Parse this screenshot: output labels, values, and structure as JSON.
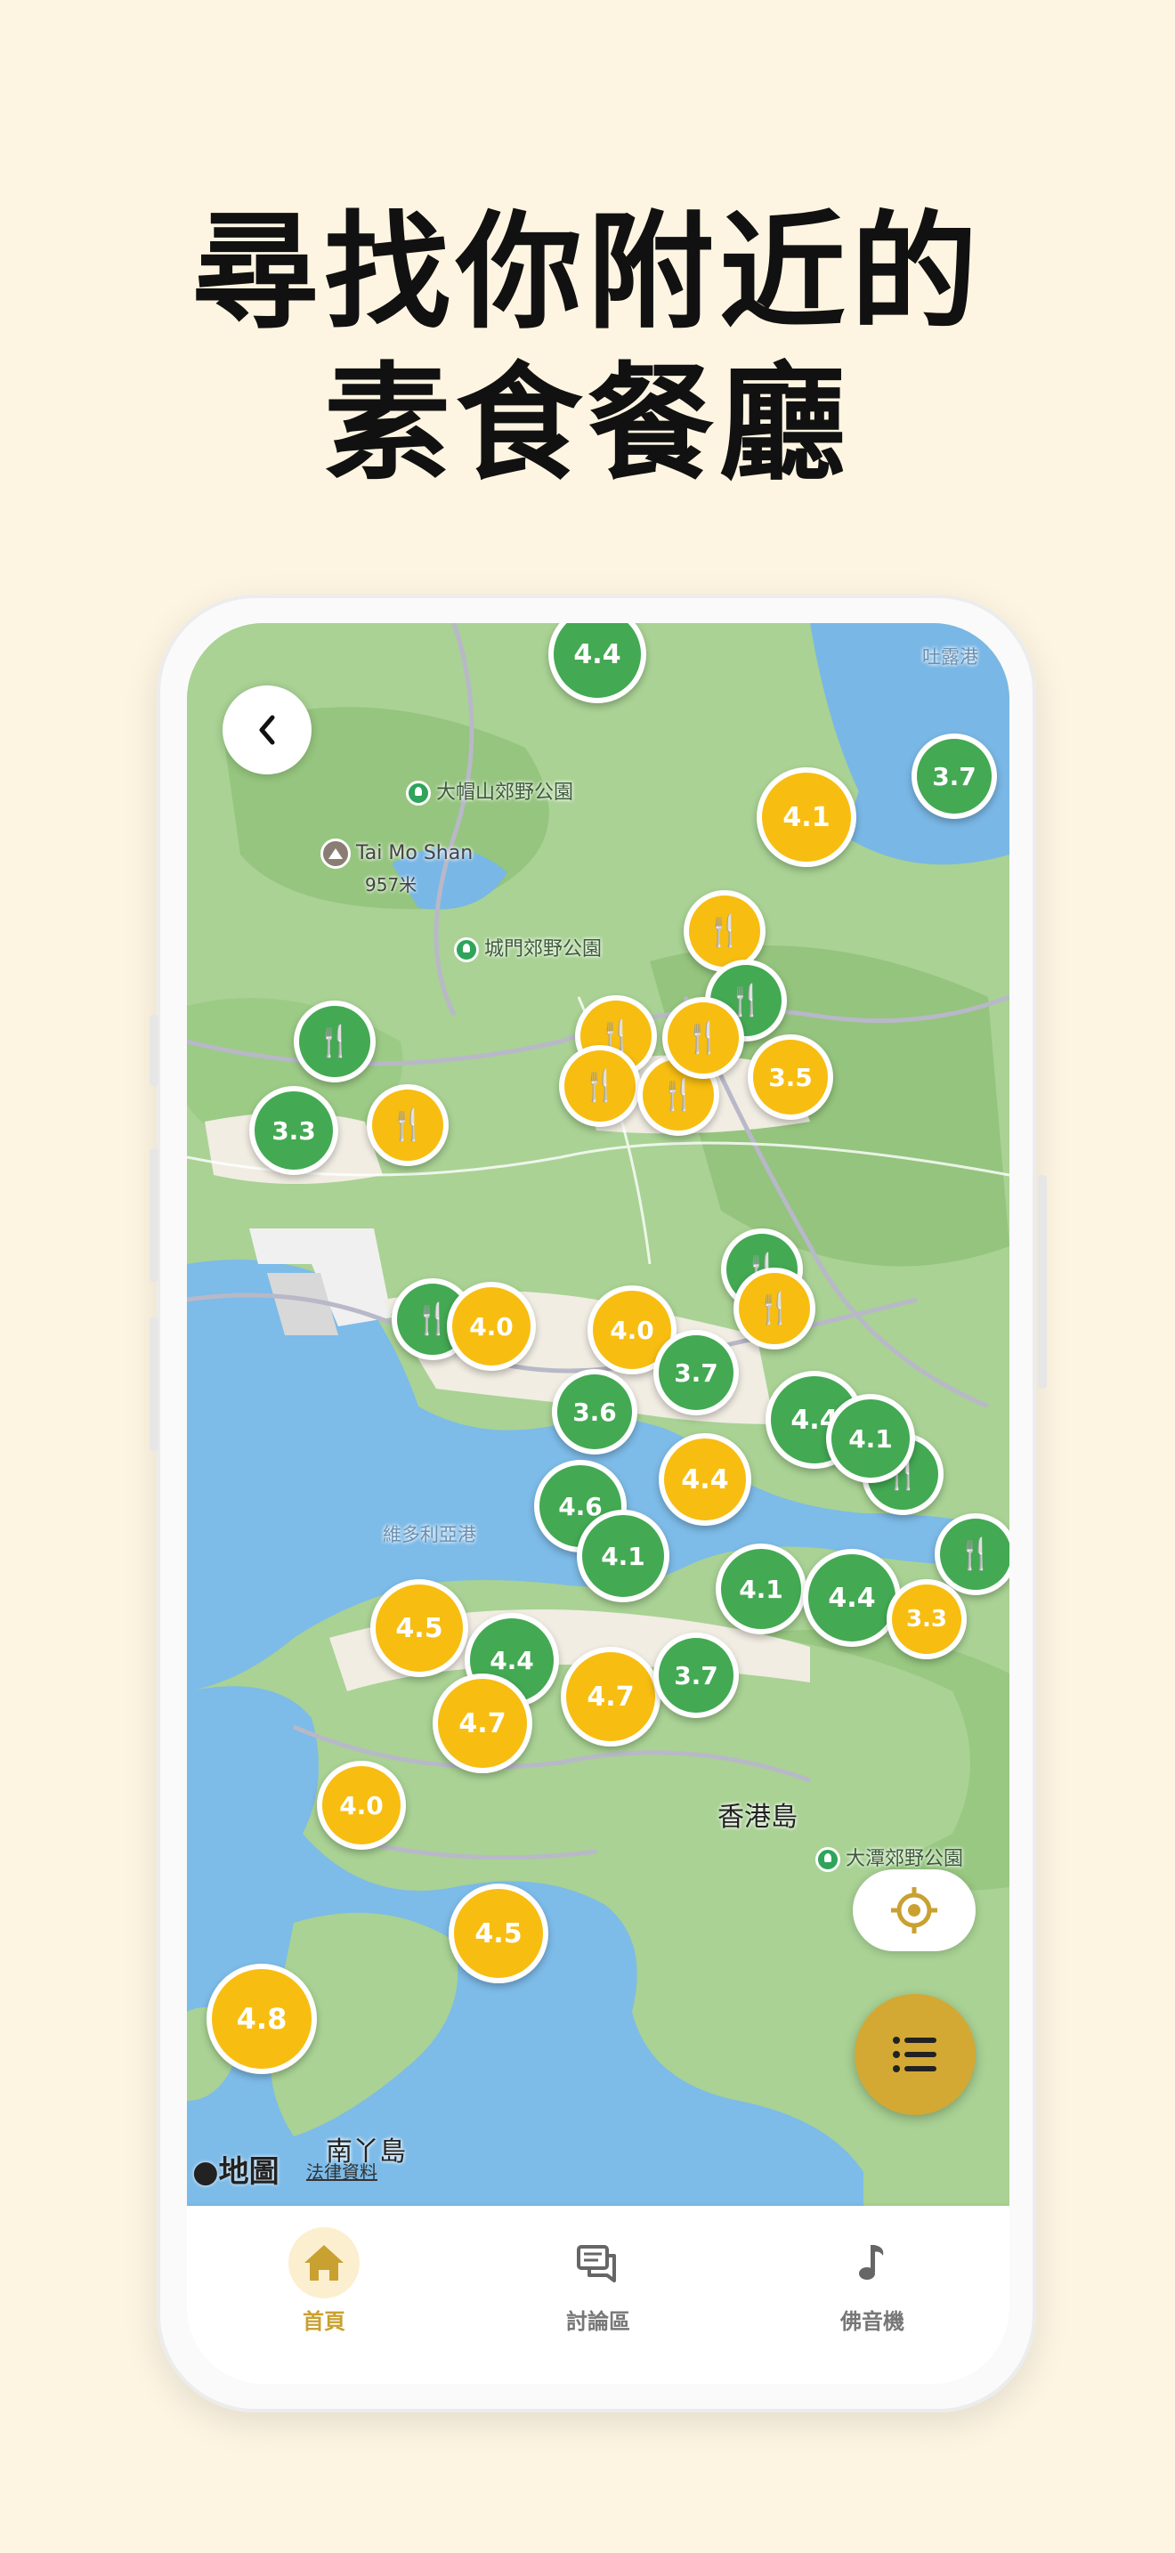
{
  "headline": {
    "line1": "尋找你附近的",
    "line2": "素食餐廳"
  },
  "colors": {
    "background": "#fdf5e2",
    "accent": "#c9a131",
    "marker_green": "#43a953",
    "marker_yellow": "#f7bd11"
  },
  "map": {
    "labels": {
      "tai_mo_shan_park": "大帽山郊野公園",
      "tai_mo_shan": "Tai Mo Shan",
      "tai_mo_shan_height": "957米",
      "shing_mun_park": "城門郊野公園",
      "tolo": "吐露港",
      "victoria_harbour": "維多利亞港",
      "hk_island": "香港島",
      "tai_tam_park": "大潭郊野公園",
      "lamma": "南丫島"
    },
    "attribution": "地圖",
    "legal": "法律資料",
    "markers": [
      {
        "id": "m1",
        "label": "4.4",
        "color": "green"
      },
      {
        "id": "m2",
        "label": "4.1",
        "color": "yellow"
      },
      {
        "id": "m3",
        "label": "3.7",
        "color": "green"
      },
      {
        "id": "m4",
        "label": "3.3",
        "color": "green"
      },
      {
        "id": "m5",
        "label": "3.5",
        "color": "yellow"
      },
      {
        "id": "m6",
        "label": "4.0",
        "color": "yellow"
      },
      {
        "id": "m7",
        "label": "4.0",
        "color": "yellow"
      },
      {
        "id": "m8",
        "label": "3.6",
        "color": "green"
      },
      {
        "id": "m9",
        "label": "3.7",
        "color": "green"
      },
      {
        "id": "m10",
        "label": "4.4",
        "color": "green"
      },
      {
        "id": "m11",
        "label": "4.1",
        "color": "green"
      },
      {
        "id": "m12",
        "label": "4.4",
        "color": "yellow"
      },
      {
        "id": "m13",
        "label": "4.6",
        "color": "green"
      },
      {
        "id": "m14",
        "label": "4.1",
        "color": "green"
      },
      {
        "id": "m15",
        "label": "4.1",
        "color": "green"
      },
      {
        "id": "m16",
        "label": "4.4",
        "color": "green"
      },
      {
        "id": "m17",
        "label": "4.5",
        "color": "yellow"
      },
      {
        "id": "m18",
        "label": "4.4",
        "color": "green"
      },
      {
        "id": "m19",
        "label": "4.7",
        "color": "yellow"
      },
      {
        "id": "m20",
        "label": "4.7",
        "color": "yellow"
      },
      {
        "id": "m21",
        "label": "3.7",
        "color": "green"
      },
      {
        "id": "m22",
        "label": "4.0",
        "color": "yellow"
      },
      {
        "id": "m23",
        "label": "4.5",
        "color": "yellow"
      },
      {
        "id": "m24",
        "label": "4.8",
        "color": "yellow"
      },
      {
        "id": "m25",
        "label": "3.3",
        "color": "yellow"
      }
    ],
    "restaurant_icon": "fork-knife-icon"
  },
  "tabs": [
    {
      "label": "首頁",
      "icon": "home-icon",
      "active": true
    },
    {
      "label": "討論區",
      "icon": "chat-icon",
      "active": false
    },
    {
      "label": "佛音機",
      "icon": "music-note-icon",
      "active": false
    }
  ]
}
